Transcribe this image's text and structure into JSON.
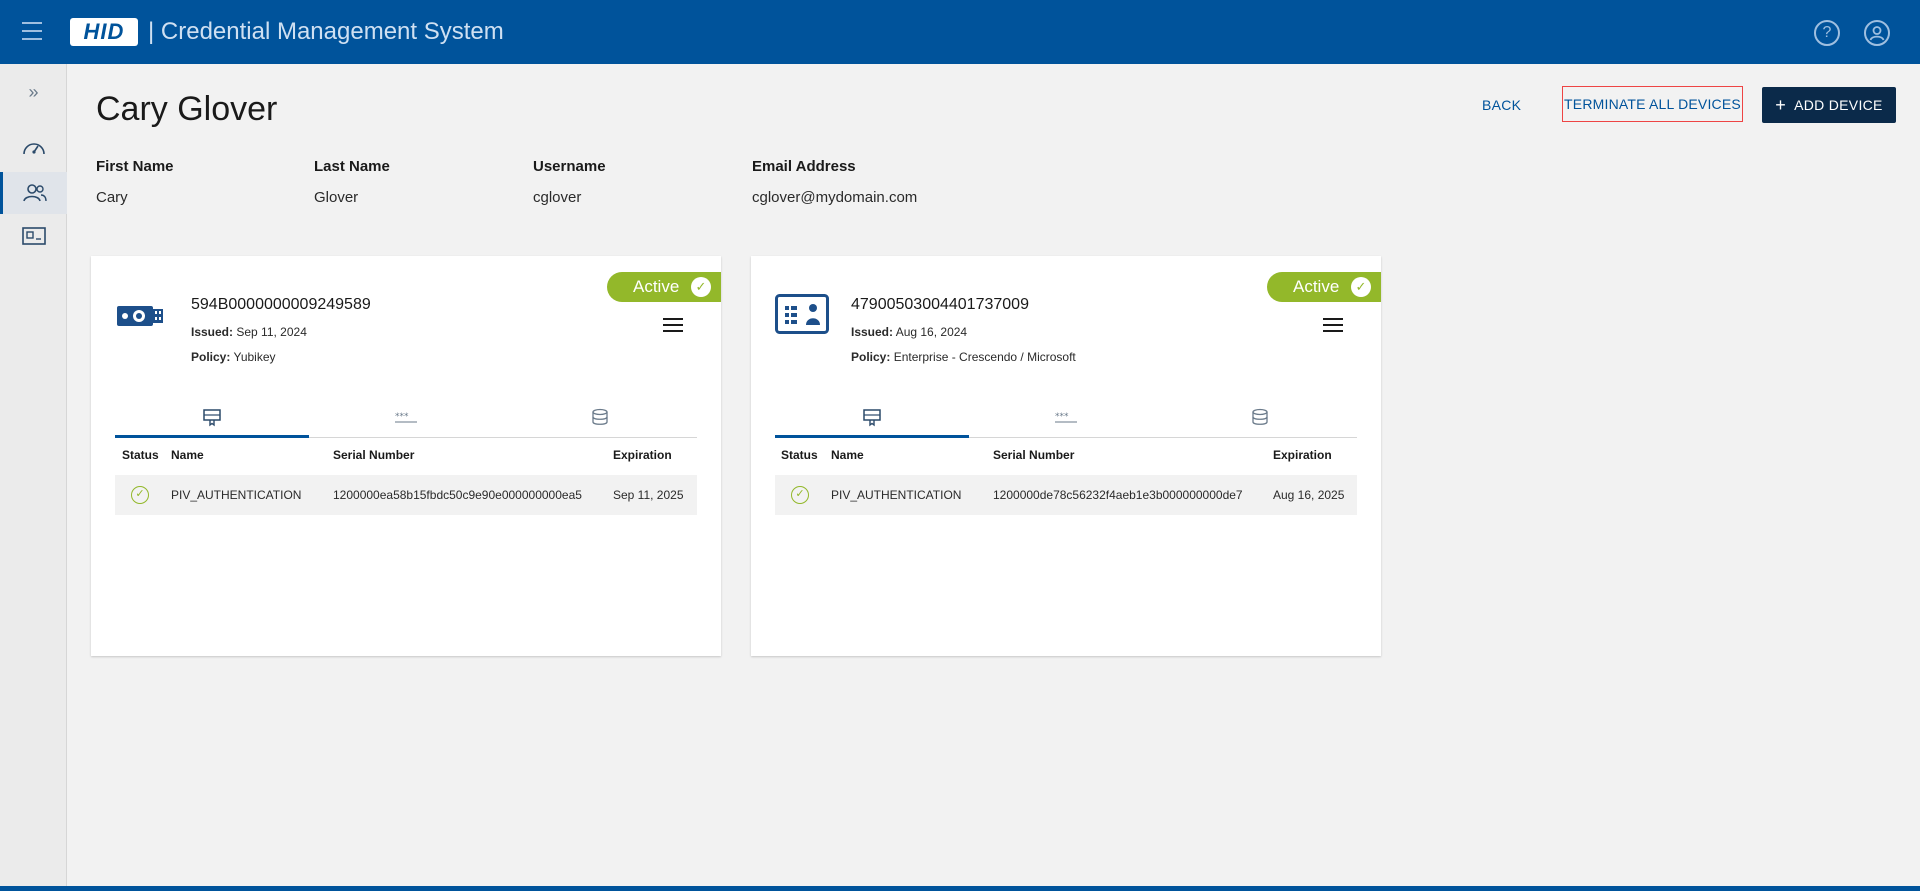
{
  "header": {
    "logo_text": "HID",
    "app_title": "| Credential Management System",
    "icons": [
      "menu-icon",
      "help-icon",
      "account-icon"
    ]
  },
  "rail": {
    "items": [
      "dashboard-icon",
      "users-icon",
      "id-card-icon"
    ],
    "active": "users-icon"
  },
  "page": {
    "title": "Cary Glover",
    "actions": {
      "back": "BACK",
      "terminate": "TERMINATE ALL DEVICES",
      "add": "ADD DEVICE"
    }
  },
  "user_info": {
    "first_name_label": "First Name",
    "first_name": "Cary",
    "last_name_label": "Last Name",
    "last_name": "Glover",
    "username_label": "Username",
    "username": "cglover",
    "email_label": "Email Address",
    "email": "cglover@mydomain.com"
  },
  "devices": [
    {
      "serial": "594B0000000009249589",
      "status": "Active",
      "issued_label": "Issued:",
      "issued": "Sep 11, 2024",
      "policy_label": "Policy:",
      "policy": "Yubikey",
      "icon": "usb-key-icon",
      "columns": [
        "Status",
        "Name",
        "Serial Number",
        "Expiration"
      ],
      "rows": [
        {
          "name": "PIV_AUTHENTICATION",
          "serial": "1200000ea58b15fbdc50c9e90e000000000ea5",
          "expiration": "Sep 11, 2025"
        }
      ]
    },
    {
      "serial": "47900503004401737009",
      "status": "Active",
      "issued_label": "Issued:",
      "issued": "Aug 16, 2024",
      "policy_label": "Policy:",
      "policy": "Enterprise - Crescendo / Microsoft",
      "icon": "smart-card-icon",
      "columns": [
        "Status",
        "Name",
        "Serial Number",
        "Expiration"
      ],
      "rows": [
        {
          "name": "PIV_AUTHENTICATION",
          "serial": "1200000de78c56232f4aeb1e3b000000000de7",
          "expiration": "Aug 16, 2025"
        }
      ]
    }
  ],
  "colors": {
    "primary": "#00539b",
    "active": "#93b82a",
    "dark_button": "#0b2a4a"
  }
}
